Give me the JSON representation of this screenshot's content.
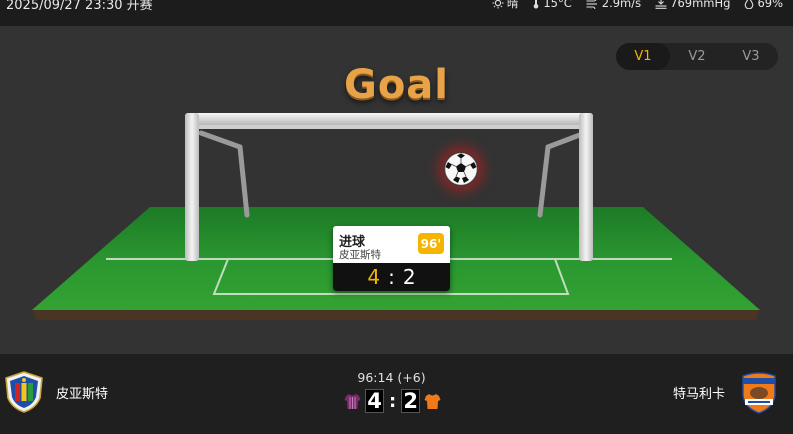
{
  "status": {
    "datetime": "2025/09/27 23:30 开赛",
    "weather": [
      {
        "icon": "sun-icon",
        "text": "晴"
      },
      {
        "icon": "thermometer-icon",
        "text": "15°C"
      },
      {
        "icon": "wind-icon",
        "text": "2.9m/s"
      },
      {
        "icon": "pressure-icon",
        "text": "769mmHg"
      },
      {
        "icon": "humidity-icon",
        "text": "69%"
      }
    ]
  },
  "view_tabs": [
    {
      "label": "V1",
      "active": true
    },
    {
      "label": "V2",
      "active": false
    },
    {
      "label": "V3",
      "active": false
    }
  ],
  "animation": {
    "title": "Goal",
    "event": {
      "label": "进球",
      "team": "皮亚斯特",
      "minute": "96'",
      "home_score": "4",
      "away_score": "2",
      "separator": ":"
    }
  },
  "match": {
    "home_team": "皮亚斯特",
    "away_team": "特马利卡",
    "clock": "96:14 (+6)",
    "home_score": "4",
    "away_score": "2",
    "separator": ":",
    "home_kit_color": "#7b2a6b",
    "away_kit_color": "#f07a1a"
  },
  "colors": {
    "accent": "#f5b400",
    "pitch": "#1f8a2a",
    "title": "#e8a248"
  }
}
